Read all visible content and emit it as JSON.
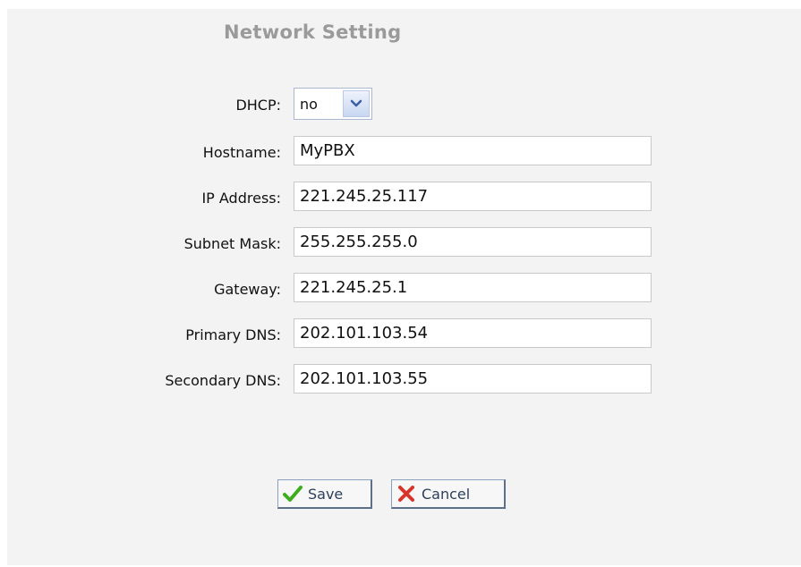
{
  "header": {
    "title": "Network Setting"
  },
  "form": {
    "dhcp": {
      "label": "DHCP:",
      "value": "no"
    },
    "hostname": {
      "label": "Hostname:",
      "value": "MyPBX"
    },
    "ip_address": {
      "label": "IP Address:",
      "value": "221.245.25.117"
    },
    "subnet_mask": {
      "label": "Subnet Mask:",
      "value": "255.255.255.0"
    },
    "gateway": {
      "label": "Gateway:",
      "value": "221.245.25.1"
    },
    "primary_dns": {
      "label": "Primary DNS:",
      "value": "202.101.103.54"
    },
    "secondary_dns": {
      "label": "Secondary DNS:",
      "value": "202.101.103.55"
    }
  },
  "actions": {
    "save": {
      "label": "Save",
      "icon": "checkmark-icon"
    },
    "cancel": {
      "label": "Cancel",
      "icon": "x-icon"
    }
  },
  "colors": {
    "panel_background": "#f3f3f3",
    "title": "#9a9a9a",
    "save_icon": "#3cae1e",
    "cancel_icon": "#d9342b"
  }
}
